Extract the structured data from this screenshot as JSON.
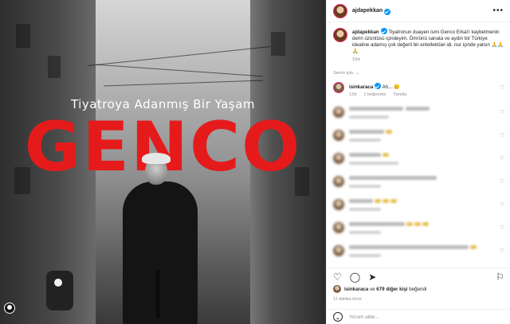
{
  "poster": {
    "subtitle": "Tiyatroya Adanmış Bir Yaşam",
    "title": "GENCO"
  },
  "post": {
    "username": "ajdapekkan",
    "more_icon": "more-horizontal-icon"
  },
  "caption": {
    "username": "ajdapekkan",
    "text": "Tiyatronun duayen ismi Genco Erkal'ı kaybetmenin derin üzüntüsü içindeyim. Ömrünü sanata ve aydın bir Türkiye idealine adamış çok değerli bir entellektüel idi. nur içinde yatsın 🙏🙏🙏",
    "time": "15d"
  },
  "for_you_label": "Senin için",
  "comments": [
    {
      "username": "isinkaraca",
      "text": "Ah....🥲",
      "time": "12d",
      "likes": "1 beğenme",
      "reply": "Yanıtla"
    }
  ],
  "likes_text": {
    "user": "isinkaraca",
    "mid": "ve",
    "others": "679 diğer kişi",
    "suffix": "beğendi"
  },
  "posted_ago": "11 dakika önce",
  "comment_input_placeholder": "Yorum ekle...",
  "colors": {
    "poster_red": "#e51b1b",
    "verified_blue": "#0095f6",
    "muted_text": "#8e8e8e"
  }
}
